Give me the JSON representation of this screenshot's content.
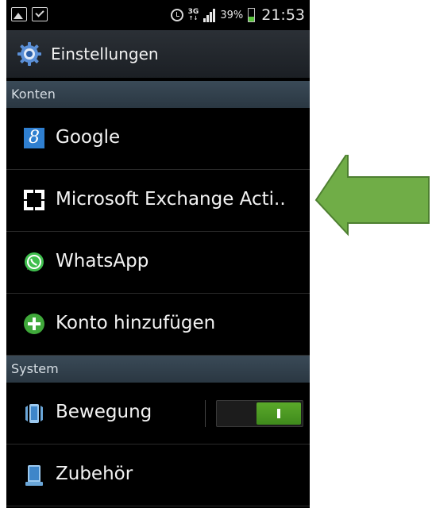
{
  "status_bar": {
    "network": "3G",
    "network_sub": "↑↓",
    "battery_percent": "39%",
    "time": "21:53",
    "icons": [
      "picture-icon",
      "check-icon",
      "alarm-icon",
      "signal-icon",
      "battery-icon"
    ]
  },
  "header": {
    "title": "Einstellungen",
    "icon": "settings-gear-icon"
  },
  "sections": {
    "accounts": {
      "label": "Konten",
      "items": [
        {
          "label": "Google",
          "icon": "google-icon"
        },
        {
          "label": "Microsoft Exchange Acti..",
          "icon": "exchange-icon"
        },
        {
          "label": "WhatsApp",
          "icon": "whatsapp-icon"
        },
        {
          "label": "Konto hinzufügen",
          "icon": "add-account-icon"
        }
      ]
    },
    "system": {
      "label": "System",
      "items": [
        {
          "label": "Bewegung",
          "icon": "motion-icon",
          "toggle": "on"
        },
        {
          "label": "Zubehör",
          "icon": "accessory-icon"
        }
      ]
    }
  },
  "annotation": {
    "icon": "green-arrow-icon",
    "color": "#70ad47"
  }
}
